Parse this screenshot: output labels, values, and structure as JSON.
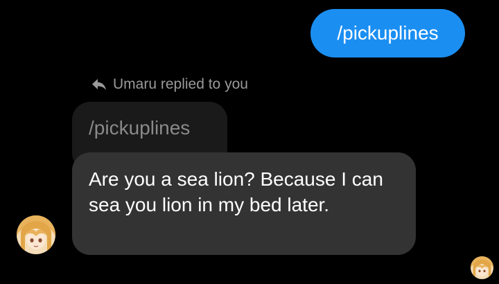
{
  "sent_message": {
    "text": "/pickuplines"
  },
  "reply_context": {
    "icon": "reply-arrow-icon",
    "label": "Umaru replied to you",
    "quoted_text": "/pickuplines"
  },
  "received_message": {
    "text": "Are you a sea lion? Because I can sea you lion in my bed later."
  },
  "avatars": {
    "sender": "umaru-avatar",
    "read_receipt": "umaru-seen-avatar"
  },
  "colors": {
    "background": "#000000",
    "sent_bubble": "#1b8ef2",
    "received_bubble": "#333333",
    "quoted_bubble": "#1a1a1a",
    "muted_text": "#9a9a9a"
  }
}
